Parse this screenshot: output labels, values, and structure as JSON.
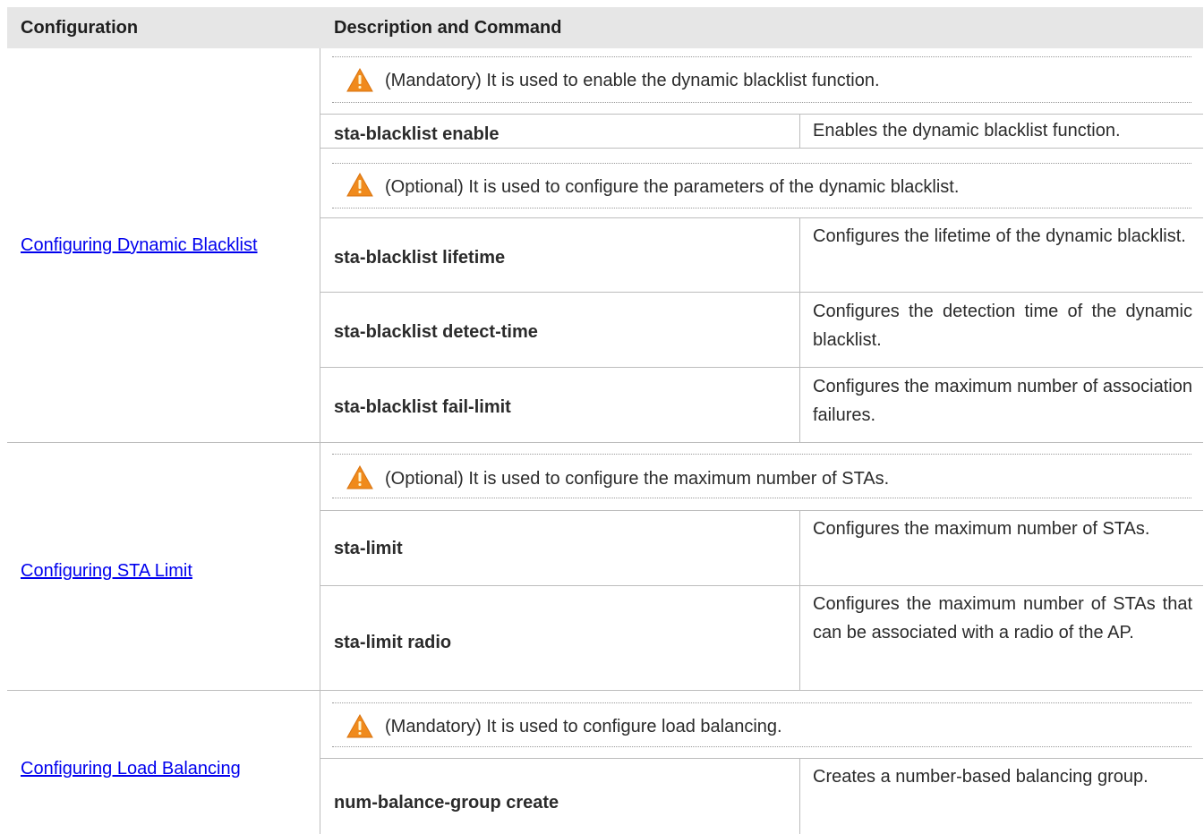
{
  "header": {
    "col1": "Configuration",
    "col2": "Description and Command"
  },
  "sections": [
    {
      "link": "Configuring Dynamic Blacklist",
      "notes": [
        "(Mandatory) It is used to enable the dynamic blacklist function.",
        "(Optional) It is used to configure the parameters of the dynamic blacklist."
      ],
      "rows": [
        {
          "command": "sta-blacklist enable",
          "description": "Enables the dynamic blacklist function."
        },
        {
          "command": "sta-blacklist lifetime",
          "description": "Configures the lifetime of the dynamic blacklist."
        },
        {
          "command": "sta-blacklist detect-time",
          "description": "Configures the detection time of the dynamic blacklist."
        },
        {
          "command": "sta-blacklist fail-limit",
          "description": "Configures the maximum number of association failures."
        }
      ]
    },
    {
      "link": "Configuring STA Limit",
      "notes": [
        "(Optional) It is used to configure the maximum number of STAs."
      ],
      "rows": [
        {
          "command": "sta-limit",
          "description": "Configures the maximum number of STAs."
        },
        {
          "command": "sta-limit radio",
          "description": "Configures the maximum number of STAs that can be associated with a radio of the AP."
        }
      ]
    },
    {
      "link": "Configuring Load Balancing",
      "notes": [
        "(Mandatory) It is used to configure load balancing."
      ],
      "rows": [
        {
          "command": "num-balance-group create",
          "description": "Creates a number-based balancing group."
        }
      ]
    }
  ],
  "colors": {
    "header_bg": "#e6e6e6",
    "link": "#0000ee",
    "warning_icon": "#f08a1c"
  },
  "icons": {
    "note_icon": "warning-triangle-icon"
  }
}
